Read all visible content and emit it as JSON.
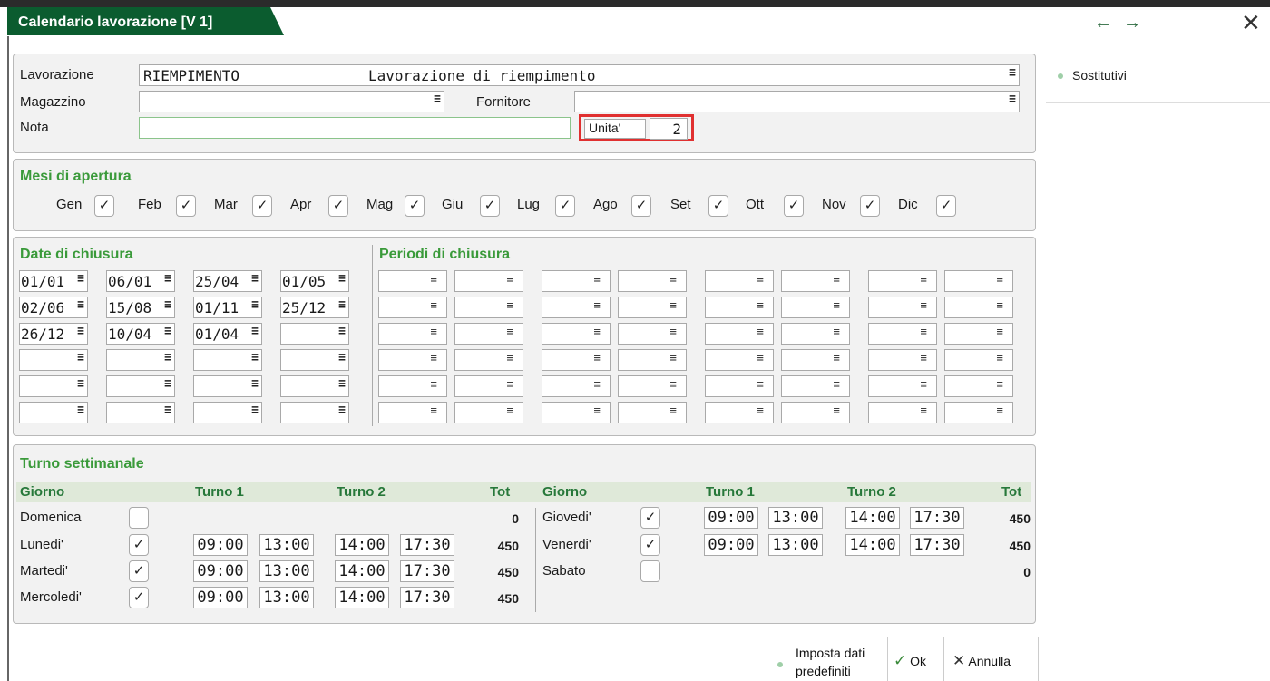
{
  "window": {
    "title": "Calendario lavorazione [V 1]"
  },
  "side": {
    "item": "Sostitutivi"
  },
  "header": {
    "lavorazione_label": "Lavorazione",
    "lavorazione_code": "RIEMPIMENTO",
    "lavorazione_desc": "Lavorazione di riempimento",
    "magazzino_label": "Magazzino",
    "magazzino_value": "",
    "fornitore_label": "Fornitore",
    "fornitore_value": "",
    "nota_label": "Nota",
    "nota_value": "",
    "unita_label": "Unita'",
    "unita_value": "2"
  },
  "months": {
    "title": "Mesi di apertura",
    "items": [
      {
        "label": "Gen",
        "checked": true
      },
      {
        "label": "Feb",
        "checked": true
      },
      {
        "label": "Mar",
        "checked": true
      },
      {
        "label": "Apr",
        "checked": true
      },
      {
        "label": "Mag",
        "checked": true
      },
      {
        "label": "Giu",
        "checked": true
      },
      {
        "label": "Lug",
        "checked": true
      },
      {
        "label": "Ago",
        "checked": true
      },
      {
        "label": "Set",
        "checked": true
      },
      {
        "label": "Ott",
        "checked": true
      },
      {
        "label": "Nov",
        "checked": true
      },
      {
        "label": "Dic",
        "checked": true
      }
    ]
  },
  "closing": {
    "dates_title": "Date di chiusura",
    "periods_title": "Periodi di chiusura",
    "dates": [
      [
        "01/01",
        "06/01",
        "25/04",
        "01/05"
      ],
      [
        "02/06",
        "15/08",
        "01/11",
        "25/12"
      ],
      [
        "26/12",
        "10/04",
        "01/04",
        ""
      ],
      [
        "",
        "",
        "",
        ""
      ],
      [
        "",
        "",
        "",
        ""
      ],
      [
        "",
        "",
        "",
        ""
      ]
    ]
  },
  "shifts": {
    "title": "Turno settimanale",
    "headers": {
      "giorno": "Giorno",
      "turno1": "Turno 1",
      "turno2": "Turno 2",
      "tot": "Tot"
    },
    "left": [
      {
        "day": "Domenica",
        "checked": false,
        "t1a": "",
        "t1b": "",
        "t2a": "",
        "t2b": "",
        "tot": "0"
      },
      {
        "day": "Lunedi'",
        "checked": true,
        "t1a": "09:00",
        "t1b": "13:00",
        "t2a": "14:00",
        "t2b": "17:30",
        "tot": "450"
      },
      {
        "day": "Martedi'",
        "checked": true,
        "t1a": "09:00",
        "t1b": "13:00",
        "t2a": "14:00",
        "t2b": "17:30",
        "tot": "450"
      },
      {
        "day": "Mercoledi'",
        "checked": true,
        "t1a": "09:00",
        "t1b": "13:00",
        "t2a": "14:00",
        "t2b": "17:30",
        "tot": "450"
      }
    ],
    "right": [
      {
        "day": "Giovedi'",
        "checked": true,
        "t1a": "09:00",
        "t1b": "13:00",
        "t2a": "14:00",
        "t2b": "17:30",
        "tot": "450"
      },
      {
        "day": "Venerdi'",
        "checked": true,
        "t1a": "09:00",
        "t1b": "13:00",
        "t2a": "14:00",
        "t2b": "17:30",
        "tot": "450"
      },
      {
        "day": "Sabato",
        "checked": false,
        "t1a": "",
        "t1b": "",
        "t2a": "",
        "t2b": "",
        "tot": "0"
      }
    ]
  },
  "footer": {
    "defaults_line1": "Imposta dati",
    "defaults_line2": "predefiniti",
    "ok": "Ok",
    "cancel": "Annulla"
  }
}
